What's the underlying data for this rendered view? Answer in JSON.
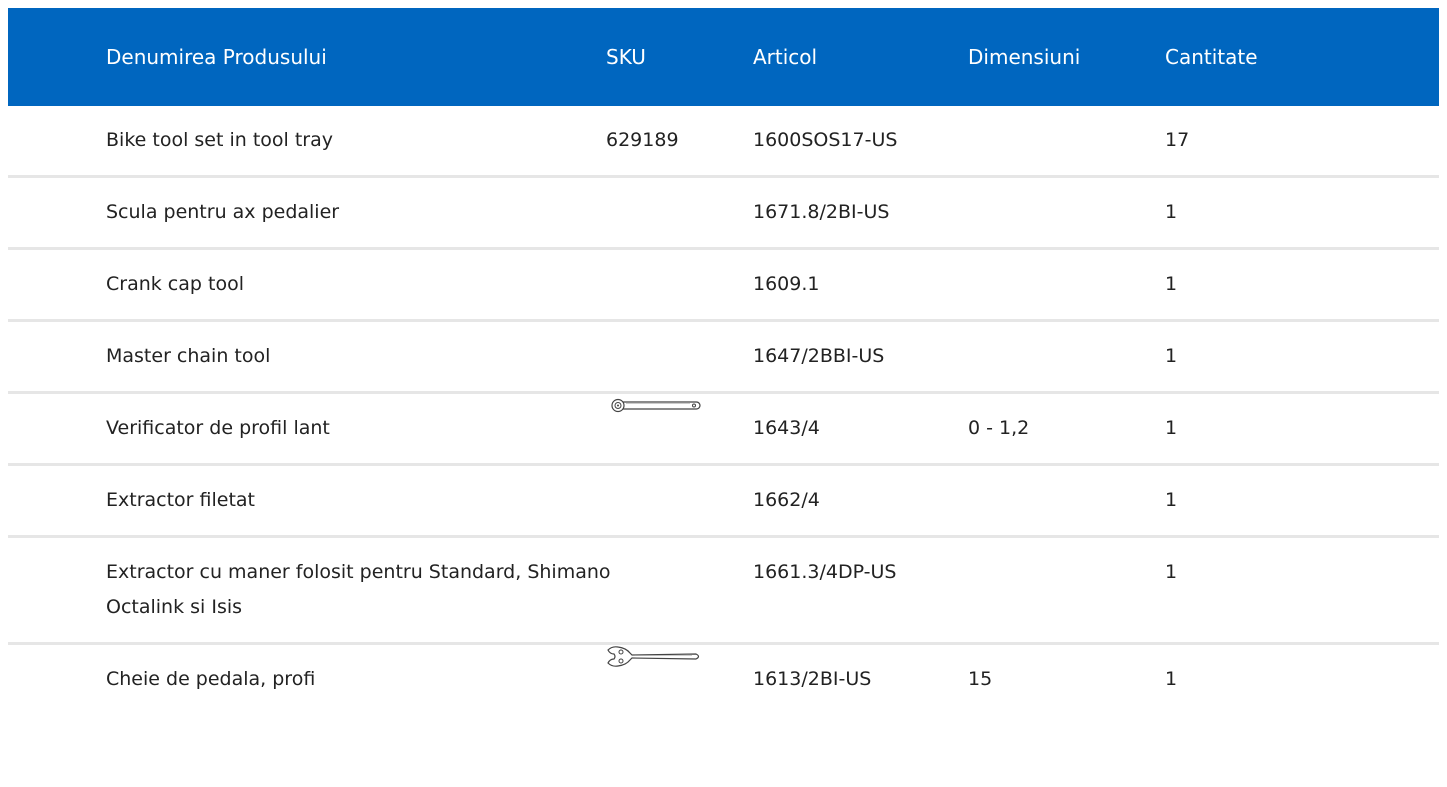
{
  "table": {
    "headers": {
      "name": "Denumirea Produsului",
      "sku": "SKU",
      "article": "Articol",
      "dimensions": "Dimensiuni",
      "quantity": "Cantitate"
    },
    "rows": [
      {
        "name": "Bike tool set in tool tray",
        "sku": "629189",
        "article": "1600SOS17-US",
        "dimensions": "",
        "quantity": "17"
      },
      {
        "name": "Scula pentru ax pedalier",
        "sku": "",
        "article": "1671.8/2BI-US",
        "dimensions": "",
        "quantity": "1"
      },
      {
        "name": "Crank cap tool",
        "sku": "",
        "article": "1609.1",
        "dimensions": "",
        "quantity": "1"
      },
      {
        "name": "Master chain tool",
        "sku": "",
        "article": "1647/2BBI-US",
        "dimensions": "",
        "quantity": "1"
      },
      {
        "name": "Verificator de profil lant",
        "sku": "",
        "sku_icon": "chain-checker-tool-icon",
        "article": "1643/4",
        "dimensions": "0 - 1,2",
        "quantity": "1"
      },
      {
        "name": "Extractor filetat",
        "sku": "",
        "article": "1662/4",
        "dimensions": "",
        "quantity": "1"
      },
      {
        "name": "Extractor cu maner folosit pentru Standard, Shimano Octalink si Isis",
        "sku": "",
        "article": "1661.3/4DP-US",
        "dimensions": "",
        "quantity": "1"
      },
      {
        "name": "Cheie de pedala, profi",
        "sku": "",
        "sku_icon": "pedal-wrench-icon",
        "article": "1613/2BI-US",
        "dimensions": "15",
        "quantity": "1"
      }
    ]
  },
  "colors": {
    "header_bg": "#0066bf",
    "header_text": "#ffffff",
    "row_divider": "#e6e6e6"
  }
}
